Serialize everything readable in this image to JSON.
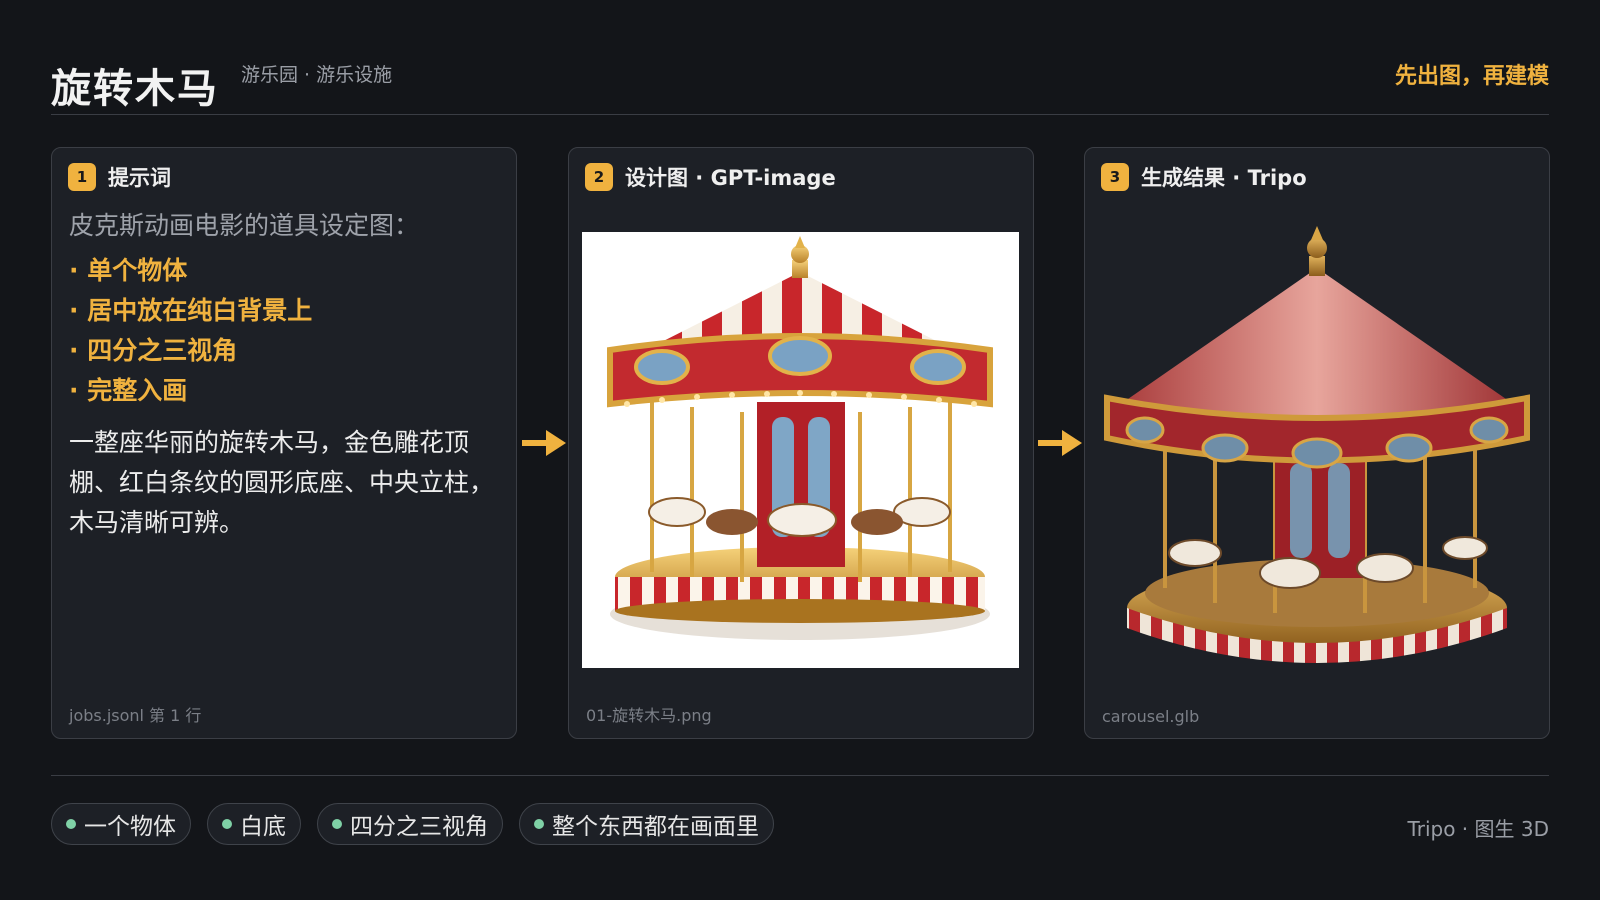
{
  "header": {
    "title": "旋转木马",
    "subtitle": "游乐园 · 游乐设施",
    "tagline": "先出图，再建模"
  },
  "cards": [
    {
      "step": "1",
      "title": "提示词",
      "intro": "皮克斯动画电影的道具设定图：",
      "bullets": [
        "单个物体",
        "居中放在纯白背景上",
        "四分之三视角",
        "完整入画"
      ],
      "body": "一整座华丽的旋转木马，金色雕花顶棚、红白条纹的圆形底座、中央立柱，木马清晰可辨。",
      "footer": "jobs.jsonl 第 1 行"
    },
    {
      "step": "2",
      "title": "设计图 · GPT-image",
      "footer": "01-旋转木马.png"
    },
    {
      "step": "3",
      "title": "生成结果 · Tripo",
      "footer": "carousel.glb"
    }
  ],
  "chips": [
    "一个物体",
    "白底",
    "四分之三视角",
    "整个东西都在画面里"
  ],
  "footer_brand": "Tripo · 图生 3D",
  "colors": {
    "background": "#131519",
    "card": "#1d2026",
    "accent": "#f0b23f",
    "chip_dot": "#7fd1a6"
  }
}
